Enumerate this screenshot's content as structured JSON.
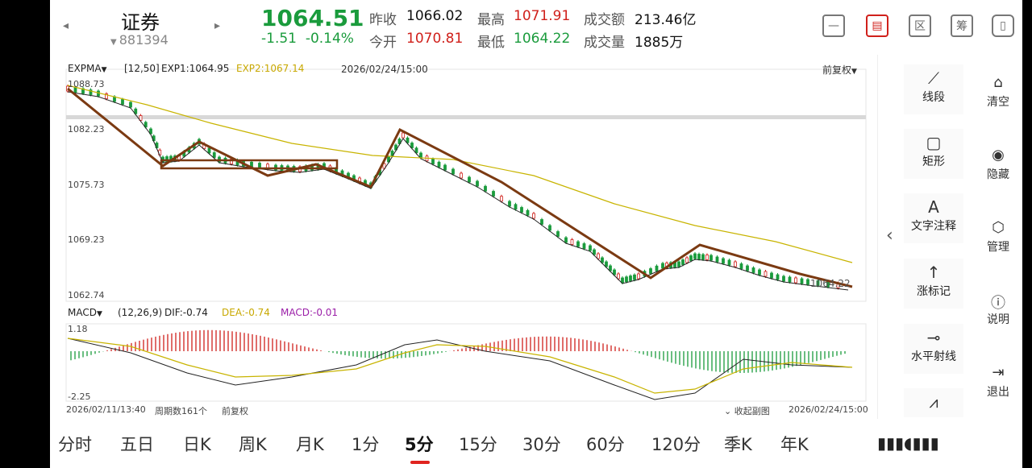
{
  "header": {
    "stock_name": "证券",
    "stock_code": "881394",
    "price": "1064.51",
    "change": "-1.51",
    "change_pct": "-0.14%",
    "quotes": {
      "prev_close_label": "昨收",
      "prev_close": "1066.02",
      "open_label": "今开",
      "open": "1070.81",
      "high_label": "最高",
      "high": "1071.91",
      "low_label": "最低",
      "low": "1064.22",
      "turnover_label": "成交额",
      "turnover": "213.46亿",
      "volume_label": "成交量",
      "volume": "1885万"
    },
    "icons": [
      "minimize-icon",
      "draw-icon",
      "area-icon",
      "chip-icon",
      "dual-screen-icon"
    ],
    "icon_glyphs": {
      "area": "区",
      "chip": "筹"
    }
  },
  "main_chart": {
    "indicator": "EXPMA",
    "params": "[12,50]",
    "exp1": "EXP1:1064.95",
    "exp2": "EXP2:1067.14",
    "datetime": "2026/02/24/15:00",
    "adjust": "前复权",
    "y_ticks": [
      "1088.73",
      "1082.23",
      "1075.73",
      "1069.23",
      "1062.74"
    ],
    "last_label": "1064.22",
    "colors": {
      "exp1": "#222222",
      "exp2": "#c8b400",
      "trend": "#7b3a12",
      "up": "#d0201b",
      "down": "#1a9b3c"
    }
  },
  "macd_chart": {
    "indicator": "MACD",
    "params": "(12,26,9)",
    "dif": "DIF:-0.74",
    "dea": "DEA:-0.74",
    "macd": "MACD:-0.01",
    "y_top": "1.18",
    "y_bottom": "-2.25",
    "collapse_label": "收起副图"
  },
  "footer": {
    "start_time": "2026/02/11/13:40",
    "period_count": "周期数161个",
    "adjust": "前复权",
    "end_time": "2026/02/24/15:00"
  },
  "tools": [
    {
      "label": "线段",
      "icon": "line-segment-icon"
    },
    {
      "label": "矩形",
      "icon": "rectangle-icon"
    },
    {
      "label": "文字注释",
      "icon": "text-note-icon",
      "glyph": "A"
    },
    {
      "label": "涨标记",
      "icon": "rise-mark-icon"
    },
    {
      "label": "水平射线",
      "icon": "horizontal-ray-icon"
    }
  ],
  "right_menu": [
    {
      "label": "清空",
      "icon": "clear-icon"
    },
    {
      "label": "隐藏",
      "icon": "hide-icon"
    },
    {
      "label": "管理",
      "icon": "manage-icon"
    },
    {
      "label": "说明",
      "icon": "help-icon"
    },
    {
      "label": "退出",
      "icon": "exit-icon"
    }
  ],
  "periods": [
    "分时",
    "五日",
    "日K",
    "周K",
    "月K",
    "1分",
    "5分",
    "15分",
    "30分",
    "60分",
    "120分",
    "季K",
    "年K"
  ],
  "active_period": "5分"
}
